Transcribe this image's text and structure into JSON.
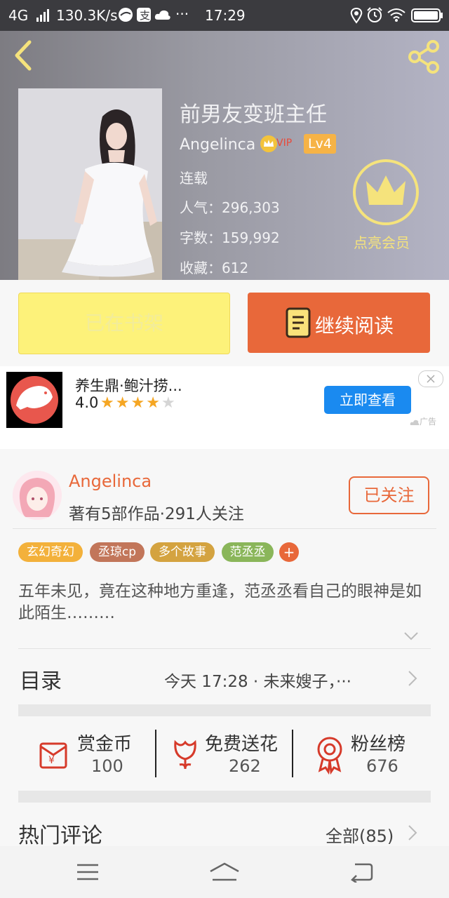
{
  "status_bar": {
    "network": "4G",
    "speed": "130.3K/s",
    "dots": "···",
    "time": "17:29"
  },
  "book": {
    "title": "前男友变班主任",
    "author": "Angelinca",
    "vip_label": "VIP",
    "level": "Lv4",
    "status": "连载",
    "popularity": "人气：296,303",
    "word_count": "字数：159,992",
    "favorites": "收藏：612",
    "member_label": "点亮会员"
  },
  "actions": {
    "shelf_label": "已在书架",
    "read_label": "继续阅读"
  },
  "ad": {
    "title": "养生鼎·鲍汁捞...",
    "rating": "4.0",
    "stars": 4,
    "cta": "立即查看",
    "ad_label": "广告"
  },
  "author_card": {
    "name": "Angelinca",
    "info": "著有5部作品·291人关注",
    "follow_label": "已关注"
  },
  "tags": [
    "玄幻奇幻",
    "丞琼cp",
    "多个故事",
    "范丞丞",
    "+"
  ],
  "synopsis": "五年未见，竟在这种地方重逢，范丞丞看自己的眼神是如此陌生………",
  "catalog": {
    "label": "目录",
    "latest": "今天 17:28 · 未来嫂子，···"
  },
  "stats": [
    {
      "label": "赏金币",
      "value": "100"
    },
    {
      "label": "免费送花",
      "value": "262"
    },
    {
      "label": "粉丝榜",
      "value": "676"
    }
  ],
  "comments": {
    "label": "热门评论",
    "all_label": "全部(85)"
  },
  "colors": {
    "accent": "#e8683a",
    "shelf_yellow": "#fdf27a",
    "gold": "#f5e37c",
    "link_blue": "#1a8af0"
  }
}
